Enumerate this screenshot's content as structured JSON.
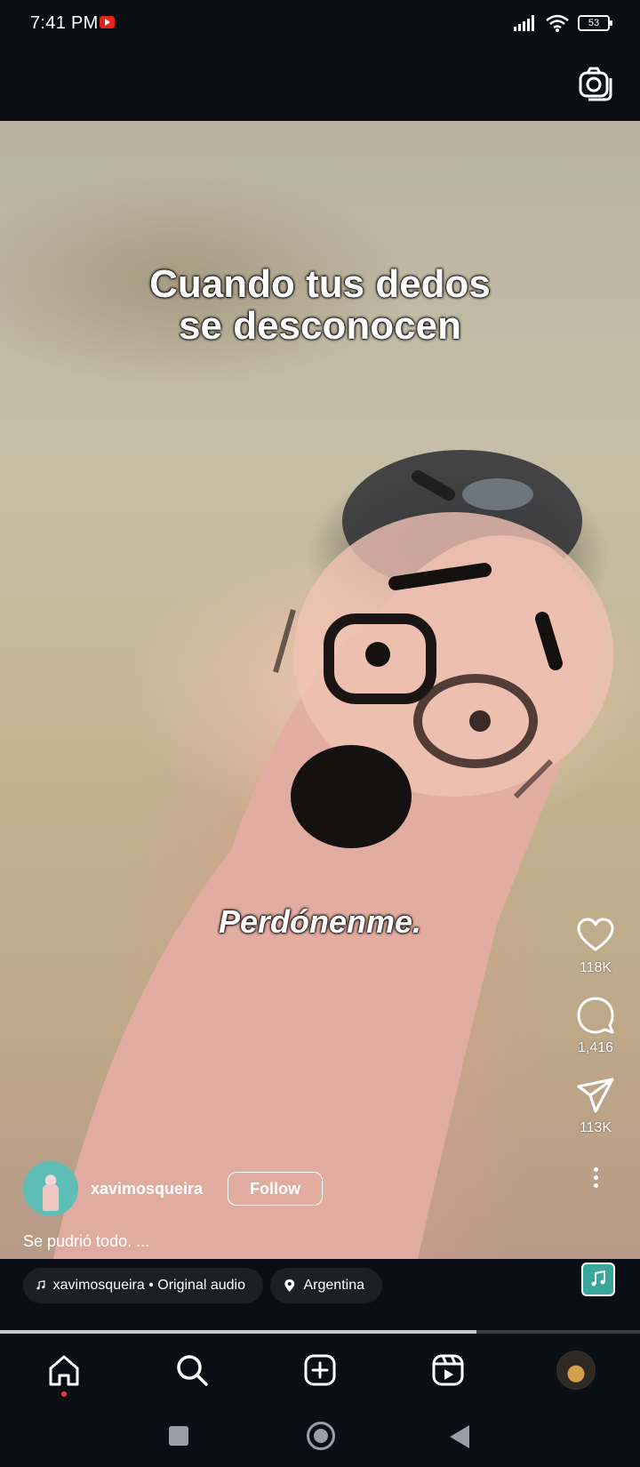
{
  "status_bar": {
    "time": "7:41 PM",
    "battery": "53"
  },
  "video": {
    "caption_top_line1": "Cuando tus dedos",
    "caption_top_line2": "se desconocen",
    "caption_mid": "Perdónenme."
  },
  "actions": {
    "likes": "118K",
    "comments": "1,416",
    "shares": "113K"
  },
  "post": {
    "username": "xavimosqueira",
    "follow_label": "Follow",
    "caption": "Se pudrió todo. ...",
    "audio": "xavimosqueira • Original audio",
    "location": "Argentina"
  },
  "progress": {
    "fraction": 0.745
  },
  "colors": {
    "background": "#0b0e14",
    "pill": "#1c1f26",
    "notification_dot": "#ff3040"
  },
  "icons": [
    "youtube-notification-icon",
    "signal-icon",
    "wifi-icon",
    "battery-icon",
    "camera-icon",
    "heart-icon",
    "comment-icon",
    "send-icon",
    "more-icon",
    "music-note-icon",
    "location-pin-icon",
    "home-icon",
    "search-icon",
    "create-icon",
    "reels-icon"
  ]
}
